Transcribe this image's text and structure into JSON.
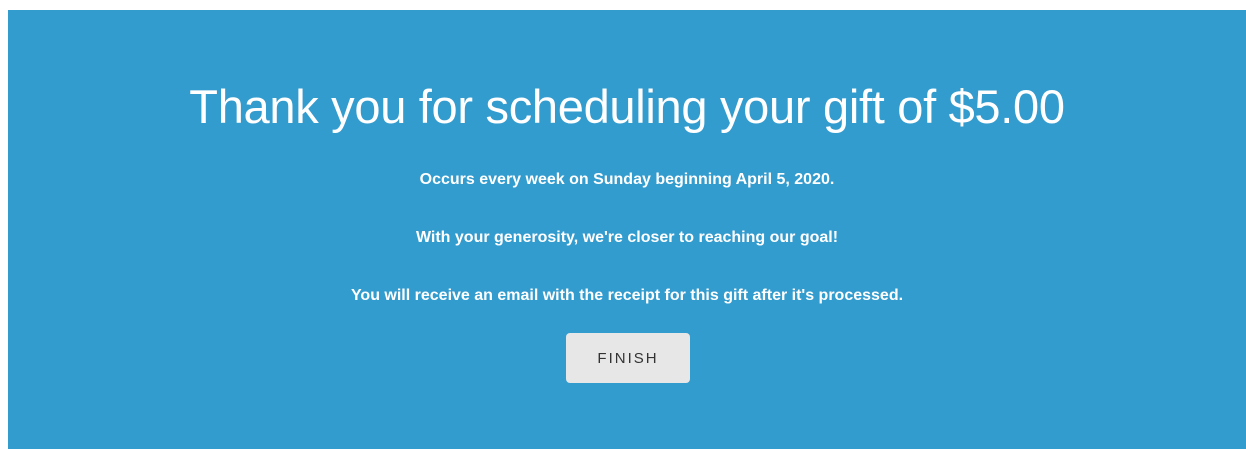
{
  "confirmation": {
    "title": "Thank you for scheduling your gift of $5.00",
    "schedule_text": "Occurs every week on Sunday beginning April 5, 2020.",
    "generosity_text": "With your generosity, we're closer to reaching our goal!",
    "receipt_text": "You will receive an email with the receipt for this gift after it's processed.",
    "finish_label": "FINISH"
  },
  "colors": {
    "panel_background": "#339ccf",
    "text": "#ffffff",
    "button_background": "#e7e7e7",
    "button_text": "#333333"
  }
}
